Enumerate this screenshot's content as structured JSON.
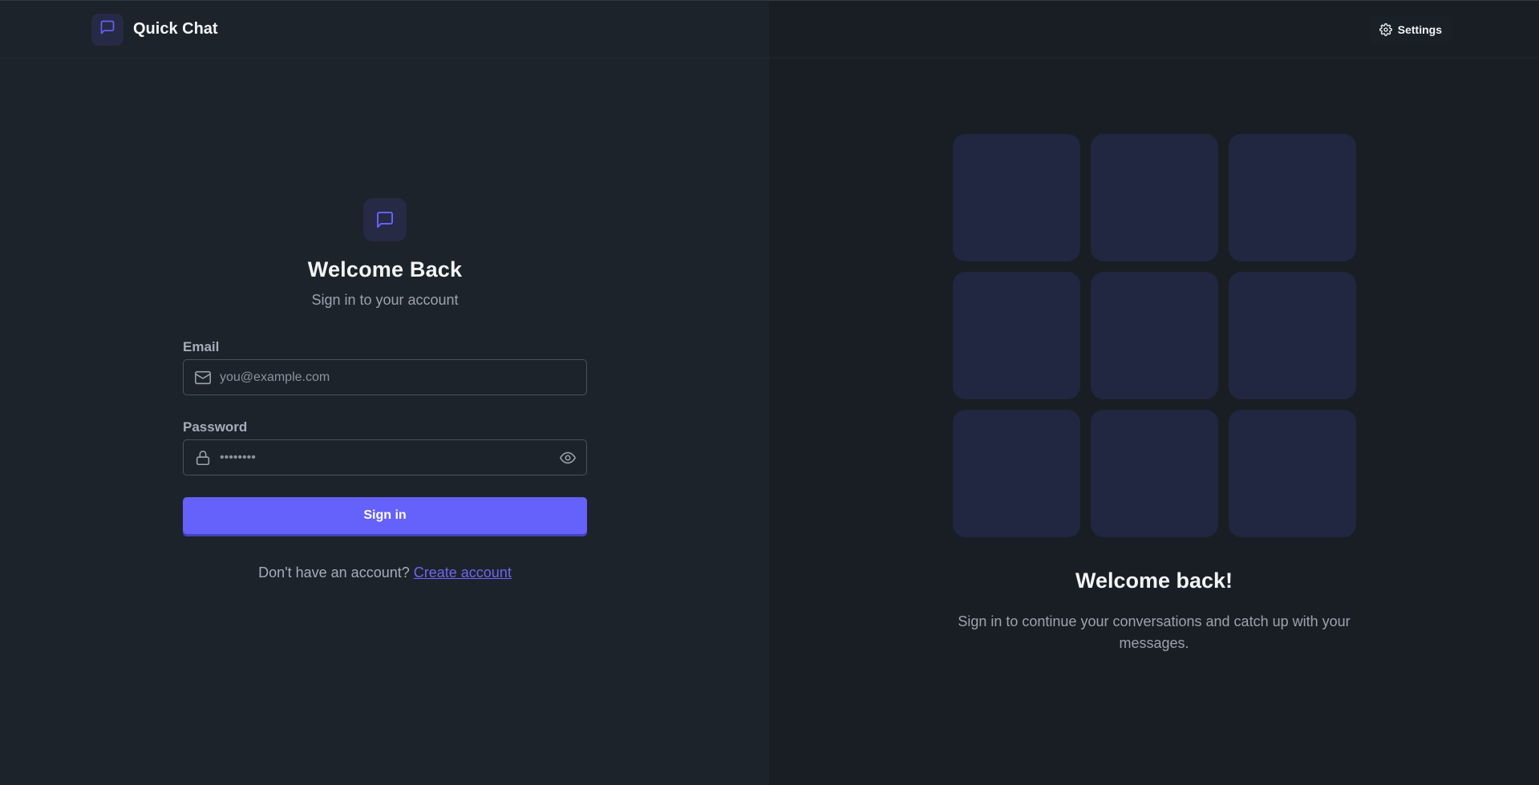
{
  "colors": {
    "accent": "#6561fb",
    "link": "#6d66f6",
    "left_background": "#1d232a",
    "right_background": "#191e24",
    "tile": "#212740"
  },
  "navbar": {
    "brand_icon": "message-square-icon",
    "brand_title": "Quick Chat",
    "settings_icon": "gear-icon",
    "settings_label": "Settings"
  },
  "login": {
    "header_icon": "message-square-icon",
    "title": "Welcome Back",
    "subtitle": "Sign in to your account",
    "email": {
      "label": "Email",
      "icon": "mail-icon",
      "placeholder": "you@example.com",
      "value": ""
    },
    "password": {
      "label": "Password",
      "icon": "lock-icon",
      "toggle_icon": "eye-icon",
      "placeholder": "••••••••",
      "value": ""
    },
    "submit_label": "Sign in",
    "signup_prompt": "Don't have an account?",
    "signup_link": "Create account"
  },
  "hero": {
    "tile_count": 9,
    "title": "Welcome back!",
    "text": "Sign in to continue your conversations and catch up with your messages."
  }
}
